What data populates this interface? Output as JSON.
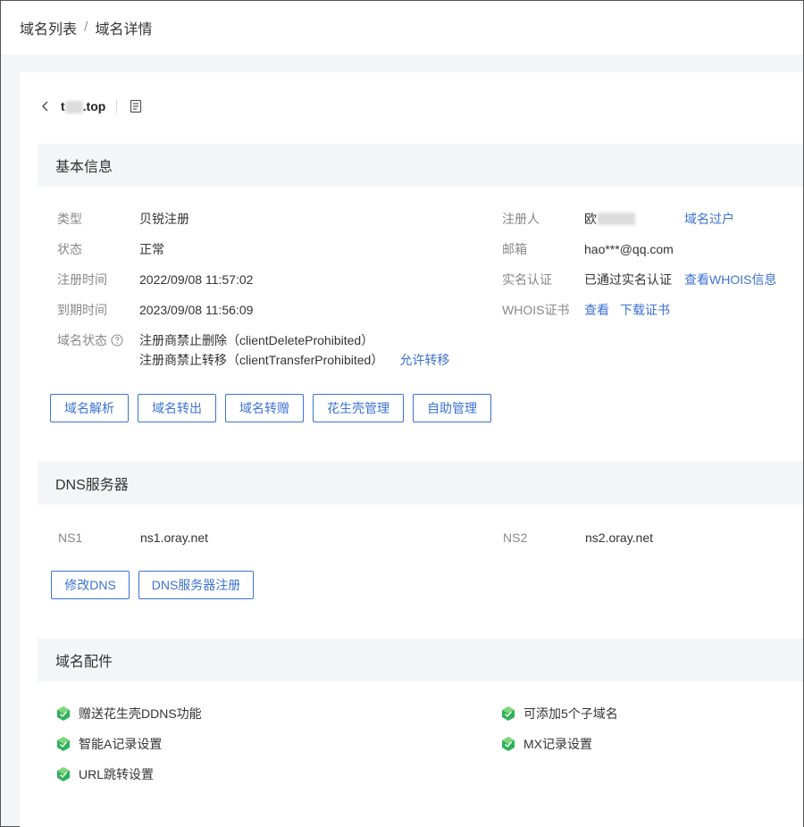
{
  "breadcrumb": {
    "item1": "域名列表",
    "separator": "/",
    "item2": "域名详情"
  },
  "domain": {
    "prefix": "t",
    "suffix": ".top",
    "back_icon": "chevron-left-icon",
    "doc_icon": "document-icon"
  },
  "basic_info": {
    "title": "基本信息",
    "type_label": "类型",
    "type_value": "贝锐注册",
    "status_label": "状态",
    "status_value": "正常",
    "reg_time_label": "注册时间",
    "reg_time_value": "2022/09/08 11:57:02",
    "exp_time_label": "到期时间",
    "exp_time_value": "2023/09/08 11:56:09",
    "domain_status_label": "域名状态",
    "domain_status_1": "注册商禁止删除（clientDeleteProhibited）",
    "domain_status_2": "注册商禁止转移（clientTransferProhibited）",
    "allow_transfer_link": "允许转移",
    "registrant_label": "注册人",
    "registrant_value": "欧",
    "transfer_owner_link": "域名过户",
    "email_label": "邮箱",
    "email_value": "hao***@qq.com",
    "realname_label": "实名认证",
    "realname_value": "已通过实名认证",
    "whois_info_link": "查看WHOIS信息",
    "whois_cert_label": "WHOIS证书",
    "whois_view_link": "查看",
    "whois_download_link": "下载证书",
    "buttons": [
      "域名解析",
      "域名转出",
      "域名转赠",
      "花生壳管理",
      "自助管理"
    ]
  },
  "dns": {
    "title": "DNS服务器",
    "ns1_label": "NS1",
    "ns1_value": "ns1.oray.net",
    "ns2_label": "NS2",
    "ns2_value": "ns2.oray.net",
    "modify_button": "修改DNS",
    "register_button": "DNS服务器注册"
  },
  "accessories": {
    "title": "域名配件",
    "items": [
      "赠送花生壳DDNS功能",
      "可添加5个子域名",
      "智能A记录设置",
      "MX记录设置",
      "URL跳转设置"
    ],
    "accent": "#2fb15a"
  },
  "colors": {
    "link": "#3c72d6",
    "section_bg": "#f4f5f7"
  }
}
